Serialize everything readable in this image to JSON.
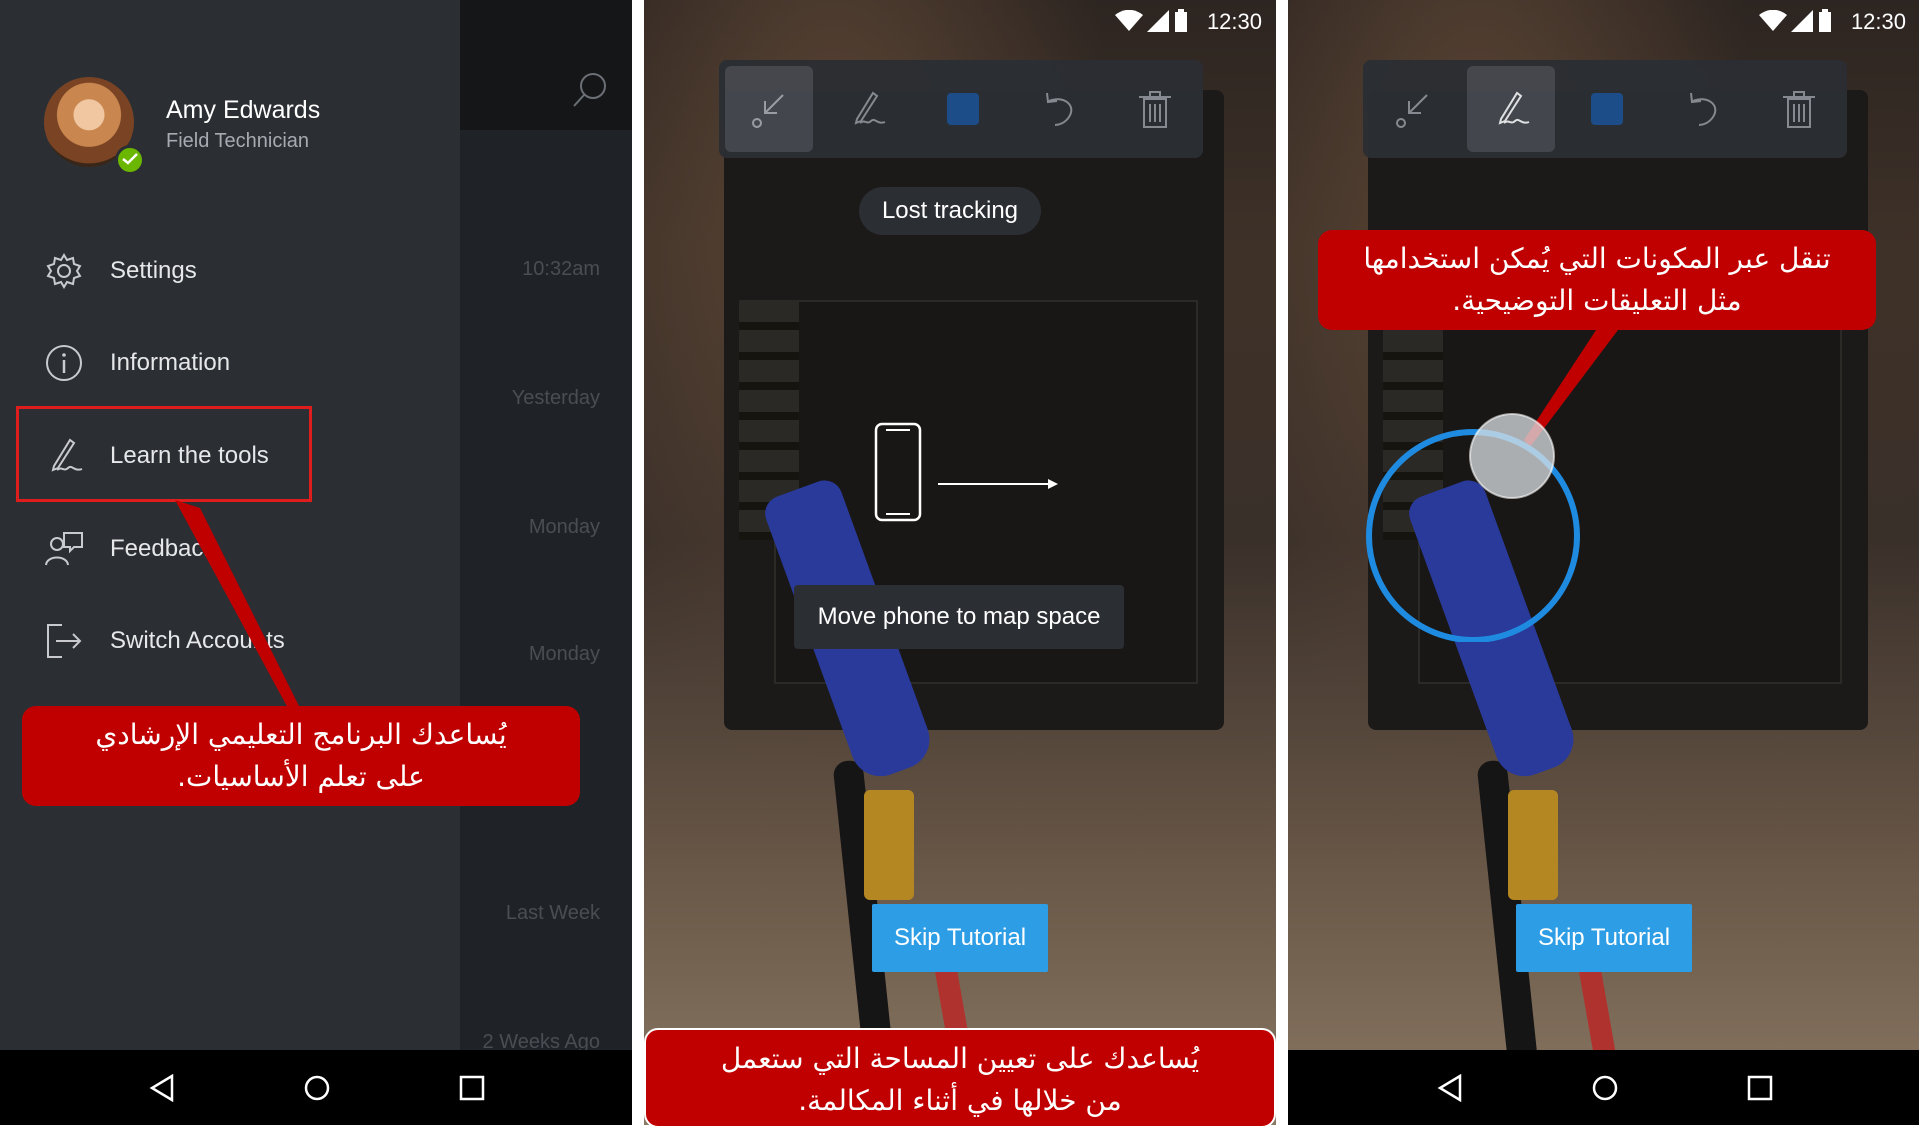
{
  "drawer": {
    "user": {
      "name": "Amy Edwards",
      "role": "Field Technician"
    },
    "menu": [
      {
        "label": "Settings",
        "icon": "gear-icon"
      },
      {
        "label": "Information",
        "icon": "info-icon"
      },
      {
        "label": "Learn the tools",
        "icon": "pen-icon"
      },
      {
        "label": "Feedback",
        "icon": "feedback-icon"
      },
      {
        "label": "Switch Accounts",
        "icon": "sign-out-icon"
      }
    ],
    "background_times": [
      "10:32am",
      "Yesterday",
      "Monday",
      "Monday",
      "Last Week",
      "2 Weeks Ago"
    ],
    "callout": {
      "line1": "يُساعدك البرنامج التعليمي الإرشادي",
      "line2": "على تعلم الأساسيات."
    }
  },
  "tracking_screen": {
    "status_time": "12:30",
    "lost_tracking_label": "Lost tracking",
    "move_phone_label": "Move phone to map space",
    "skip_label": "Skip Tutorial",
    "callout": {
      "line1": "يُساعدك على تعيين المساحة التي ستعمل",
      "line2": "من خلالها في أثناء المكالمة."
    }
  },
  "tools_screen": {
    "status_time": "12:30",
    "skip_label": "Skip Tutorial",
    "callout": {
      "line1": "تنقل عبر المكونات التي يُمكن استخدامها",
      "line2": "مثل التعليقات التوضيحية."
    }
  },
  "toolbar_tools": [
    "pointer-tool-icon",
    "pen-tool-icon",
    "color-swatch-icon",
    "undo-icon",
    "trash-icon"
  ],
  "colors": {
    "callout_red": "#c00000",
    "accent_blue": "#2d9de5",
    "drawer_bg": "#2b2e33",
    "toolbar_bg": "#2b2e33",
    "swatch_blue": "#1e4f8c",
    "highlight_red": "#e01d1d"
  }
}
